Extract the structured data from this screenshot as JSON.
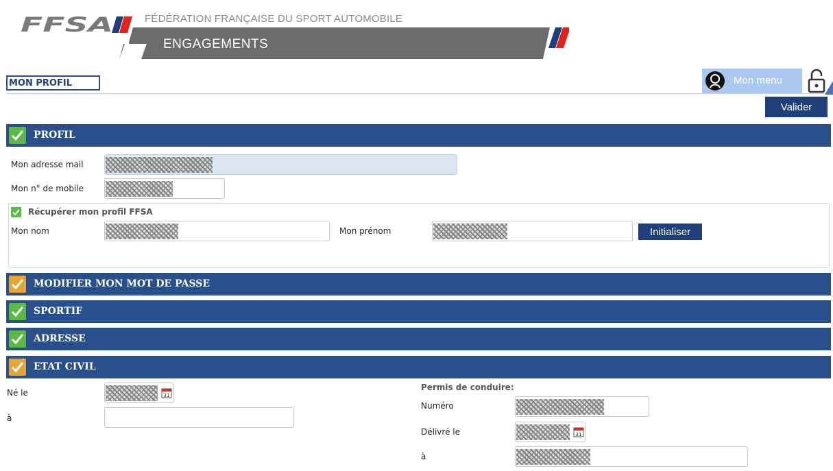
{
  "header": {
    "logo_text": "FFSA",
    "federation_name": "FÉDÉRATION FRANÇAISE DU SPORT AUTOMOBILE",
    "banner_title": "ENGAGEMENTS"
  },
  "page": {
    "title": "MON PROFIL"
  },
  "top_actions": {
    "menu_label": "Mon menu",
    "valider_label": "Valider"
  },
  "sections": {
    "profil": {
      "label": "PROFIL",
      "status": "complete"
    },
    "mot_de_passe": {
      "label": "MODIFIER MON MOT DE PASSE",
      "status": "incomplete"
    },
    "sportif": {
      "label": "SPORTIF",
      "status": "complete"
    },
    "adresse": {
      "label": "ADRESSE",
      "status": "complete"
    },
    "etat_civil": {
      "label": "ETAT CIVIL",
      "status": "incomplete"
    }
  },
  "profil_form": {
    "email_label": "Mon adresse mail",
    "mobile_label": "Mon n° de mobile",
    "recover_label": "Récupérer mon profil FFSA",
    "nom_label": "Mon nom",
    "prenom_label": "Mon prénom",
    "init_label": "Initialiser"
  },
  "etat_civil_form": {
    "ne_le_label": "Né le",
    "a_label": "à",
    "permis_title": "Permis de conduire:",
    "numero_label": "Numéro",
    "delivre_label": "Délivré le",
    "permis_a_label": "à",
    "calendar_day": "31"
  },
  "colors": {
    "bar_blue": "#2a508b",
    "button_navy": "#1f3f7a",
    "check_green": "#5cb944",
    "check_orange": "#e9a531",
    "menu_light_blue": "#aac8f0",
    "accent_red": "#e2231a"
  },
  "icons": {
    "menu_avatar": "user-avatar-icon",
    "lock": "unlock-icon",
    "calendar": "calendar-icon",
    "check": "check-icon"
  }
}
